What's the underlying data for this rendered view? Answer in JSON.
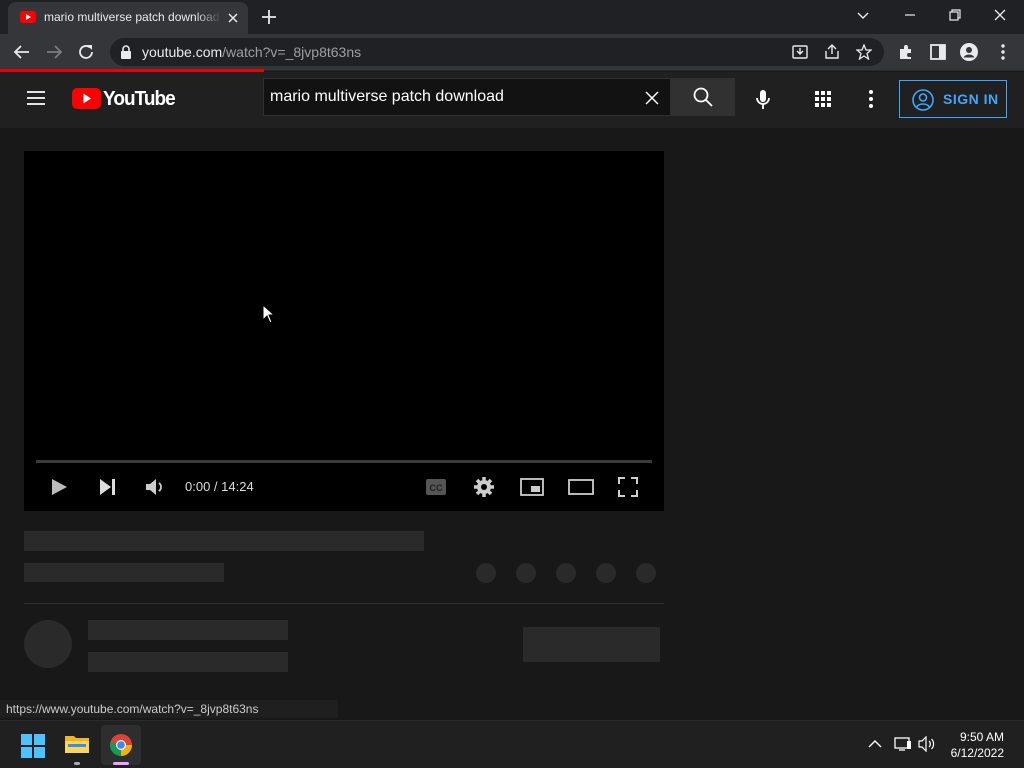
{
  "browser": {
    "tab": {
      "title": "mario multiverse patch download - YouTube",
      "favicon": "youtube-icon"
    },
    "url": {
      "host": "youtube.com",
      "path": "/watch?v=_8jvp8t63ns"
    },
    "status_url": "https://www.youtube.com/watch?v=_8jvp8t63ns"
  },
  "youtube": {
    "logo_text": "YouTube",
    "search": {
      "value": "mario multiverse patch download",
      "placeholder": "Search"
    },
    "sign_in_label": "SIGN IN",
    "accent": "#3ea6ff",
    "brand_red": "#ff0000"
  },
  "player": {
    "current_time": "0:00",
    "duration": "14:24",
    "time_display": "0:00 / 14:24",
    "progress": 0
  },
  "taskbar": {
    "time": "9:50 AM",
    "date": "6/12/2022",
    "apps": [
      "start-icon",
      "file-explorer-icon",
      "chrome-icon"
    ]
  }
}
